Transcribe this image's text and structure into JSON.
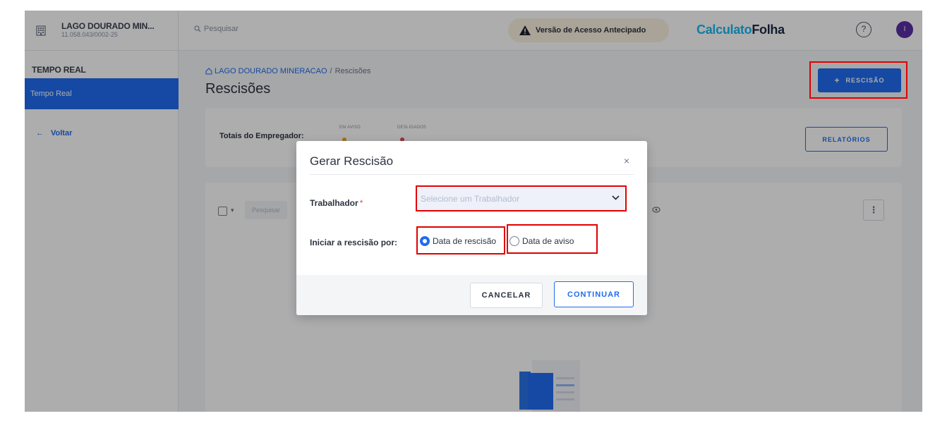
{
  "sidebar": {
    "company_name": "LAGO DOURADO MIN...",
    "company_cnpj": "11.058.043/0002-25",
    "section_title": "TEMPO REAL",
    "active_item": "Tempo Real",
    "back_label": "Voltar"
  },
  "topbar": {
    "search_placeholder": "Pesquisar",
    "early_access": "Versão de Acesso Antecipado",
    "brand_part1": "Calculato",
    "brand_part2": "Folha",
    "help": "?",
    "avatar": "I"
  },
  "main": {
    "breadcrumb_company": "LAGO DOURADO MINERACAO",
    "breadcrumb_sep": "/",
    "breadcrumb_page": "Rescisões",
    "title": "Rescisões",
    "add_button": "RESCISÃO",
    "add_button_plus": "+",
    "totals_label": "Totais do Empregador:",
    "totals_col1": "EM AVISO",
    "totals_col2": "DESLIGADOS",
    "reports_button": "RELATÓRIOS",
    "list_search_placeholder": "Pesquisar",
    "kebab": "⋮"
  },
  "modal": {
    "title": "Gerar Rescisão",
    "close": "×",
    "worker_label": "Trabalhador",
    "required_mark": "*",
    "worker_placeholder": "Selecione um Trabalhador",
    "start_label": "Iniciar a rescisão por:",
    "option1": "Data de rescisão",
    "option2": "Data de aviso",
    "cancel": "CANCELAR",
    "continue": "CONTINUAR"
  },
  "colors": {
    "primary": "#1f6cf0",
    "brand_light": "#17b9f1",
    "brand_dark": "#1d2a44",
    "highlight": "#e00000",
    "warning_dot": "#f0a81a",
    "danger_dot": "#e24b4b"
  }
}
